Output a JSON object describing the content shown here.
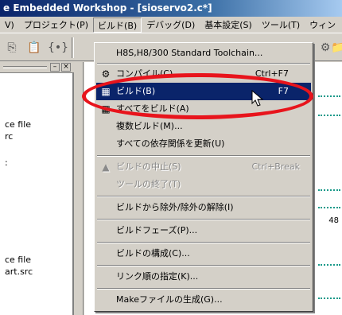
{
  "window": {
    "title": "e Embedded Workshop - [sioservo2.c*]"
  },
  "menubar": {
    "items": [
      {
        "label": "V)"
      },
      {
        "label": "プロジェクト(P)"
      },
      {
        "label": "ビルド(B)"
      },
      {
        "label": "デバッグ(D)"
      },
      {
        "label": "基本設定(S)"
      },
      {
        "label": "ツール(T)"
      },
      {
        "label": "ウィン"
      }
    ]
  },
  "leftpane": {
    "lines": [
      "ce file",
      "rc",
      ":",
      "ce file",
      "art.src"
    ]
  },
  "editor": {
    "number": "48"
  },
  "build_menu": {
    "toolchain": "H8S,H8/300 Standard Toolchain...",
    "compile": {
      "label": "コンパイル(C)",
      "shortcut": "Ctrl+F7"
    },
    "build": {
      "label": "ビルド(B)",
      "shortcut": "F7"
    },
    "build_all": "すべてをビルド(A)",
    "multi_build": "複数ビルド(M)...",
    "update_deps": "すべての依存関係を更新(U)",
    "stop_build": {
      "label": "ビルドの中止(S)",
      "shortcut": "Ctrl+Break"
    },
    "stop_tool": "ツールの終了(T)",
    "exclude": "ビルドから除外/除外の解除(I)",
    "phases": "ビルドフェーズ(P)...",
    "config": "ビルドの構成(C)...",
    "link_order": "リンク順の指定(K)...",
    "makefile": "Makeファイルの生成(G)..."
  },
  "annotation": {
    "color": "#e8141c"
  }
}
